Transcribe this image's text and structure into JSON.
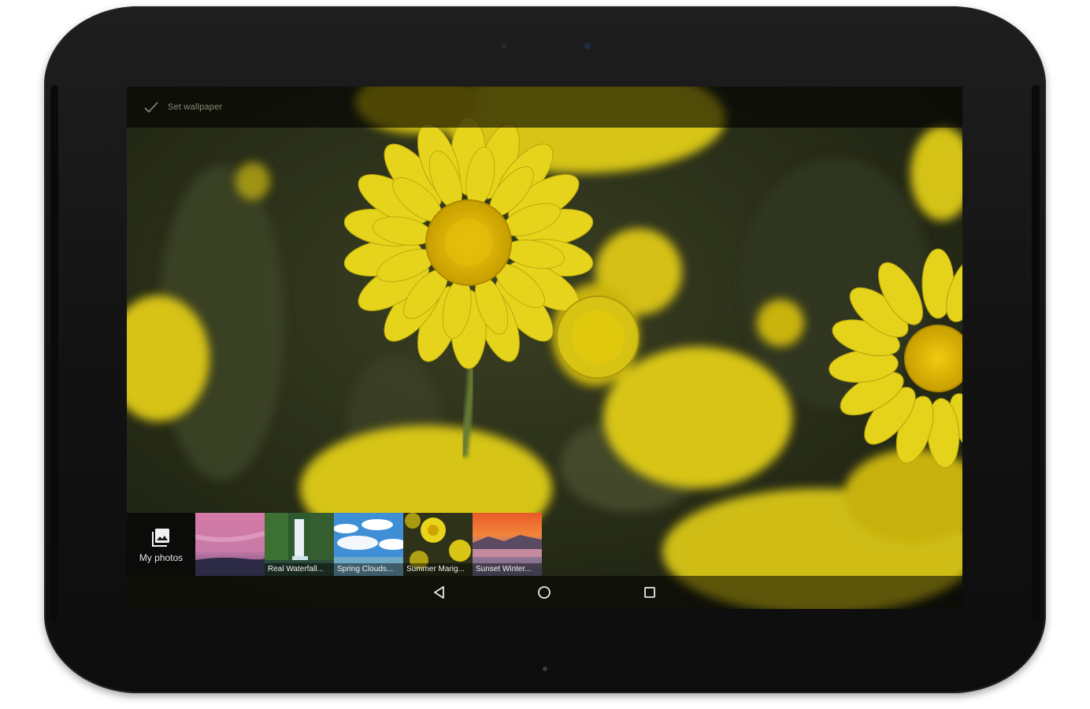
{
  "action_bar": {
    "set_wallpaper_label": "Set wallpaper",
    "icon": "check-icon"
  },
  "picker": {
    "my_photos_label": "My photos",
    "my_photos_icon": "photo-library-icon",
    "tiles": [
      {
        "caption": ""
      },
      {
        "caption": "Real Waterfall..."
      },
      {
        "caption": "Spring Clouds..."
      },
      {
        "caption": "Summer Marig..."
      },
      {
        "caption": "Sunset Winter..."
      }
    ]
  },
  "nav": {
    "back_icon": "back-triangle-icon",
    "home_icon": "home-circle-icon",
    "recents_icon": "recents-square-icon"
  },
  "colors": {
    "flower_yellow": "#e8d51c",
    "flower_center": "#d9b400",
    "foliage": "#2f3420",
    "bar_overlay": "#000000"
  }
}
